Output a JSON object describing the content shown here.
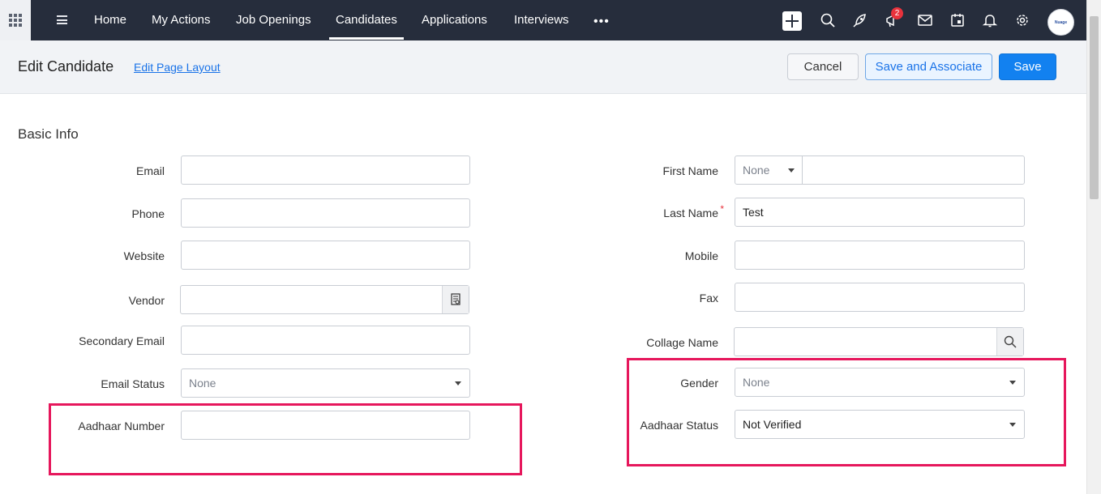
{
  "nav": {
    "items": [
      "Home",
      "My Actions",
      "Job Openings",
      "Candidates",
      "Applications",
      "Interviews"
    ],
    "active": "Candidates",
    "more": "•••",
    "notification_count": "2",
    "avatar_text": "Nuage",
    "icons": [
      "apps-grid-icon",
      "menu-icon",
      "plus-icon",
      "search-icon",
      "rocket-icon",
      "announcement-icon",
      "mail-icon",
      "calendar-icon",
      "bell-icon",
      "gear-icon"
    ]
  },
  "header": {
    "title": "Edit Candidate",
    "layout_link": "Edit Page Layout",
    "cancel_label": "Cancel",
    "save_associate_label": "Save and Associate",
    "save_label": "Save"
  },
  "form": {
    "section_title": "Basic Info",
    "left": {
      "email": {
        "label": "Email",
        "value": ""
      },
      "phone": {
        "label": "Phone",
        "value": ""
      },
      "website": {
        "label": "Website",
        "value": ""
      },
      "vendor": {
        "label": "Vendor",
        "value": ""
      },
      "secondary_email": {
        "label": "Secondary Email",
        "value": ""
      },
      "email_status": {
        "label": "Email Status",
        "value": "None"
      },
      "aadhaar_number": {
        "label": "Aadhaar Number",
        "value": ""
      }
    },
    "right": {
      "first_name": {
        "label": "First Name",
        "salutation": "None",
        "value": ""
      },
      "last_name": {
        "label": "Last Name",
        "required_mark": "*",
        "value": "Test"
      },
      "mobile": {
        "label": "Mobile",
        "value": ""
      },
      "fax": {
        "label": "Fax",
        "value": ""
      },
      "collage_name": {
        "label": "Collage Name",
        "value": ""
      },
      "gender": {
        "label": "Gender",
        "value": "None"
      },
      "aadhaar_status": {
        "label": "Aadhaar Status",
        "value": "Not Verified"
      }
    }
  },
  "colors": {
    "topbar": "#262d3c",
    "primary": "#1281f0",
    "highlight": "#e6175c",
    "required": "#e8323c"
  }
}
